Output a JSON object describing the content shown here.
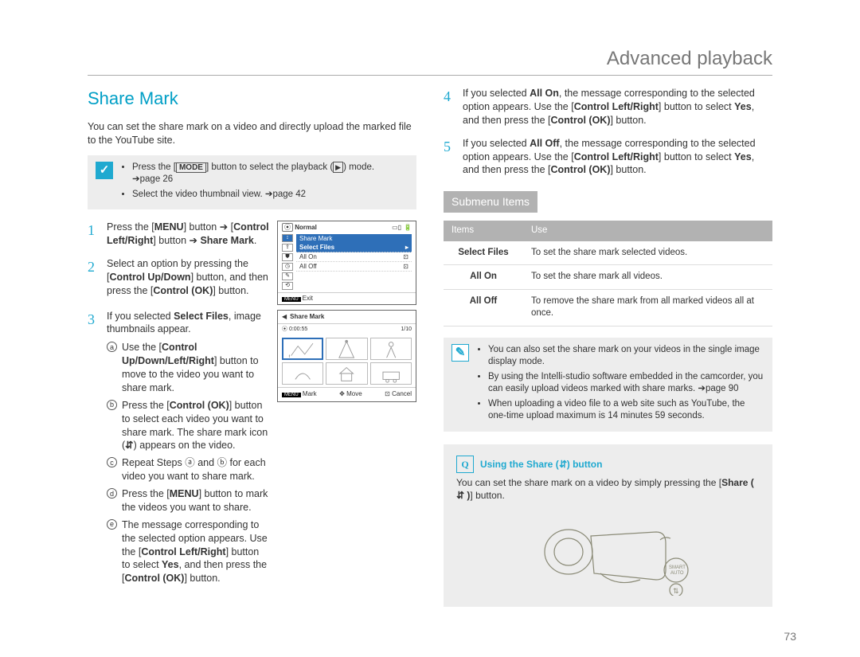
{
  "header": {
    "chapter": "Advanced playback"
  },
  "page_number": "73",
  "left": {
    "title": "Share Mark",
    "intro": "You can set the share mark on a video and directly upload the marked file to the YouTube site.",
    "note": {
      "b1_pre": "Press the [",
      "b1_mode": "MODE",
      "b1_post": "] button to select the playback (",
      "b1_tail": ") mode. ",
      "b1_ref": "➔page 26",
      "b2": "Select the video thumbnail view. ➔page 42"
    },
    "step1": {
      "a": "Press the [",
      "menu": "MENU",
      "b": "] button ➔ [",
      "ctrl": "Control Left/Right",
      "c": "] button ➔ ",
      "share": "Share Mark",
      "d": "."
    },
    "step2": {
      "a": "Select an option by pressing the [",
      "updown": "Control Up/Down",
      "b": "] button, and then press the [",
      "ok": "Control (OK)",
      "c": "] button."
    },
    "step3": {
      "a": "If you selected ",
      "sf": "Select Files",
      "b": ", image thumbnails appear."
    },
    "sub": {
      "a": {
        "pre": "Use the [",
        "ctrl": "Control Up/Down/Left/Right",
        "post": "] button to move to the video you want to share mark."
      },
      "b": {
        "pre": "Press the [",
        "ok": "Control (OK)",
        "mid": "] button to select each video you want to share mark. The share mark icon (",
        "post": ") appears on the video."
      },
      "c": {
        "txt": "Repeat Steps ⓐ and ⓑ for each video you want to share mark."
      },
      "d": {
        "pre": "Press the [",
        "menu": "MENU",
        "post": "] button to mark the videos you want to share."
      },
      "e": {
        "pre": "The message corresponding to the selected option appears. Use the [",
        "ctrl": "Control Left/Right",
        "mid": "] button to select ",
        "yes": "Yes",
        "mid2": ", and then press the [",
        "ok": "Control (OK)",
        "post": "] button."
      }
    },
    "screen1": {
      "normal": "Normal",
      "header": "Share Mark",
      "options": [
        "Select Files",
        "All On",
        "All Off"
      ],
      "exit": "Exit",
      "menu_btn": "MENU"
    },
    "screen2": {
      "title": "Share Mark",
      "time": "0:00:55",
      "count": "1/10",
      "footer": {
        "mark": "Mark",
        "move": "Move",
        "cancel": "Cancel",
        "menu_btn": "MENU"
      }
    }
  },
  "right": {
    "step4": {
      "a": "If you selected ",
      "allon": "All On",
      "b": ", the message corresponding to the selected option appears. Use the [",
      "ctrl": "Control Left/Right",
      "c": "] button to select ",
      "yes": "Yes",
      "d": ", and then press the [",
      "ok": "Control (OK)",
      "e": "] button."
    },
    "step5": {
      "a": "If you selected ",
      "alloff": "All Off",
      "b": ", the message corresponding to the selected option appears. Use the [",
      "ctrl": "Control Left/Right",
      "c": "] button to select ",
      "yes": "Yes",
      "d": ", and then press the [",
      "ok": "Control (OK)",
      "e": "] button."
    },
    "submenu_title": "Submenu Items",
    "table": {
      "h1": "Items",
      "h2": "Use",
      "r1a": "Select Files",
      "r1b": "To set the share mark selected videos.",
      "r2a": "All On",
      "r2b": "To set the share mark all videos.",
      "r3a": "All Off",
      "r3b": "To remove the share mark from all marked videos all at once."
    },
    "note2": {
      "b1": "You can also set the share mark on your videos in the single image display mode.",
      "b2": "By using the Intelli-studio software embedded in the camcorder, you can easily upload videos marked with share marks. ➔page 90",
      "b3": "When uploading a video file to a web site such as YouTube, the one-time upload maximum is 14 minutes 59 seconds."
    },
    "callout": {
      "title_pre": "Using the Share (",
      "title_post": ") button",
      "body_pre": "You can set the share mark on a video by simply pressing the [",
      "share": "Share (",
      "share_post": ")",
      "body_post": "] button."
    }
  }
}
